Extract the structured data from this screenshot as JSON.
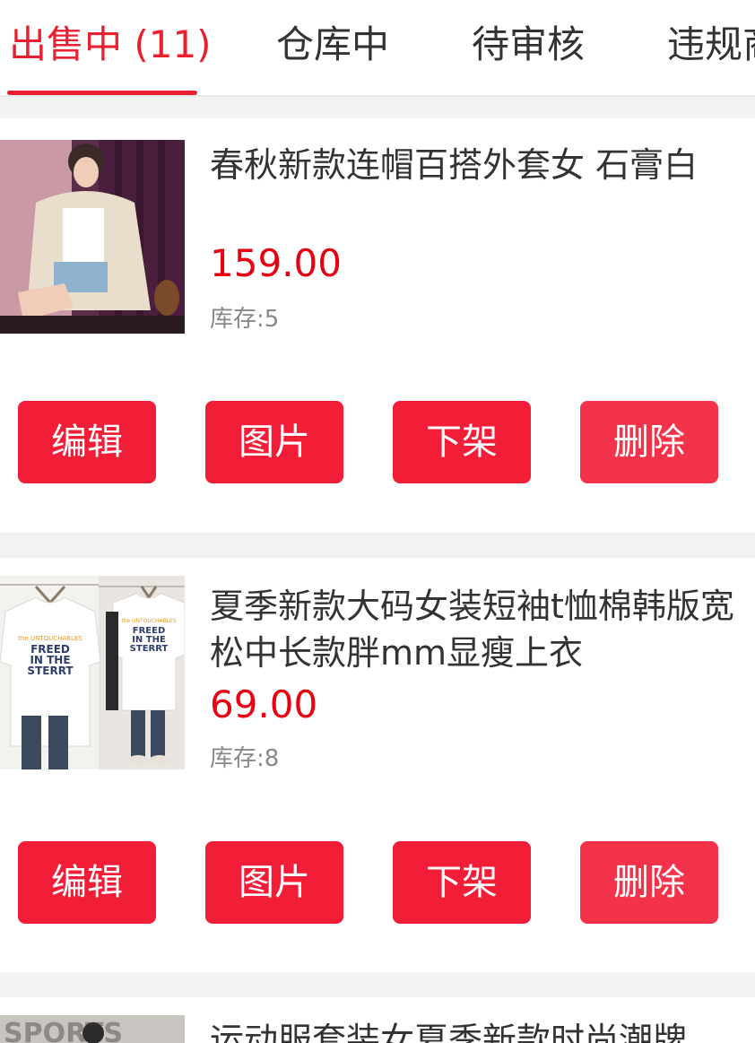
{
  "tabs": [
    {
      "label": "出售中 (11)",
      "active": true
    },
    {
      "label": "仓库中"
    },
    {
      "label": "待审核"
    },
    {
      "label": "违规商"
    }
  ],
  "products": [
    {
      "title": "春秋新款连帽百搭外套女 石膏白",
      "price": "159.00",
      "stock_label": "库存:",
      "stock_value": "5",
      "image": "product-photo-hooded-jacket-woman"
    },
    {
      "title": "夏季新款大码女装短袖t恤棉韩版宽松中长款胖mm显瘦上衣",
      "price": "69.00",
      "stock_label": "库存:",
      "stock_value": "8",
      "image": "product-photo-white-tshirt",
      "shirt_print_small": "the UNTOUCHABLES",
      "shirt_print": "FREED IN THE STERRT"
    },
    {
      "title": "运动服套装女夏季新款时尚潮牌",
      "image": "product-photo-sports-suit",
      "banner_text": "SPORTS"
    }
  ],
  "actions": {
    "edit": "编辑",
    "images": "图片",
    "delist": "下架",
    "delete": "删除"
  },
  "colors": {
    "accent": "#e8202f",
    "price": "#e60012",
    "button": "#f21d36"
  }
}
